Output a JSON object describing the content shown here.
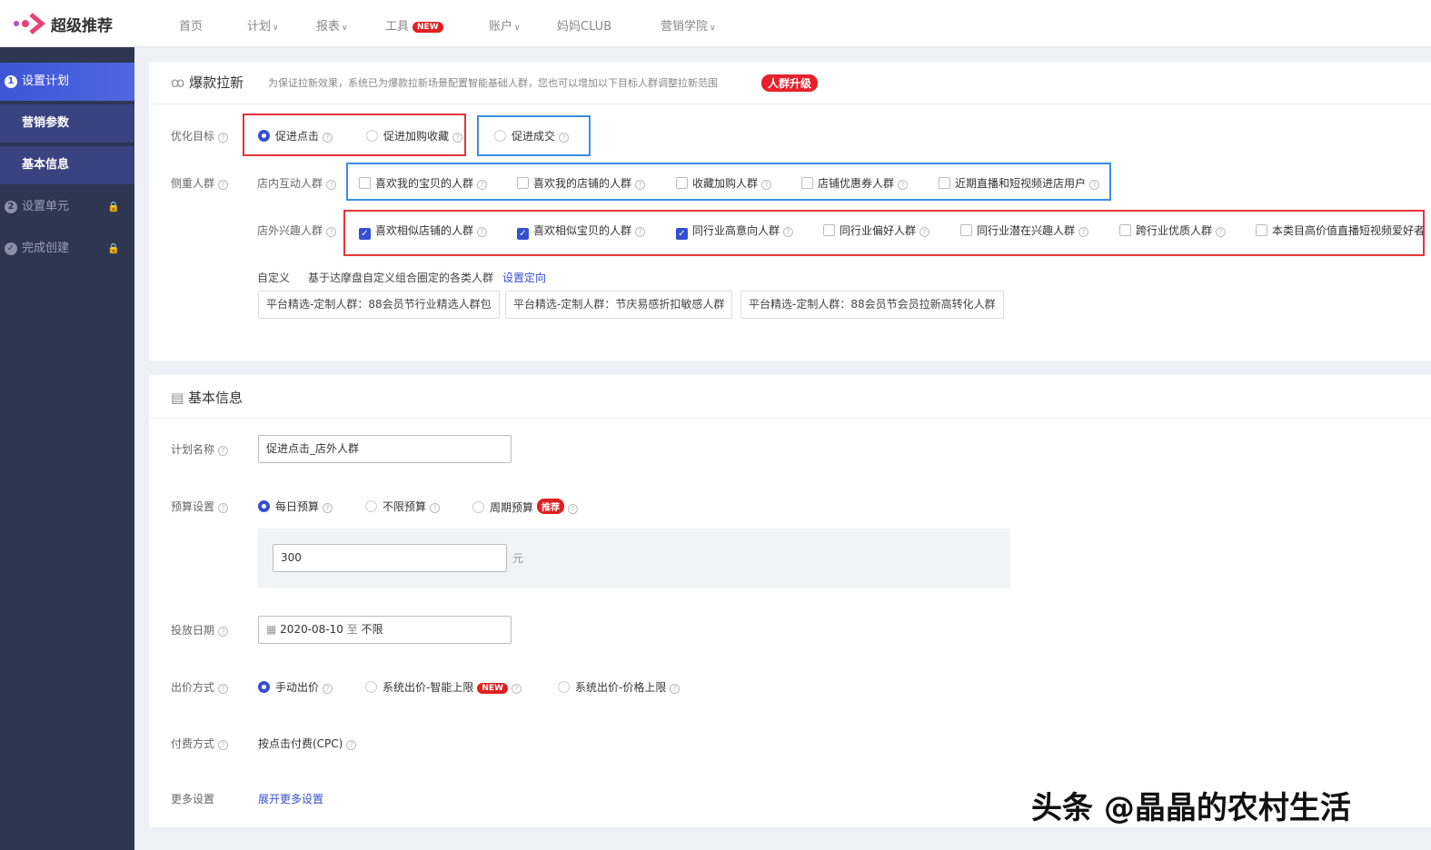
{
  "header": {
    "logo": "超级推荐",
    "nav": [
      {
        "label": "首页",
        "dropdown": false
      },
      {
        "label": "计划",
        "dropdown": true
      },
      {
        "label": "报表",
        "dropdown": true
      },
      {
        "label": "工具",
        "badge": "NEW"
      },
      {
        "label": "账户",
        "dropdown": true
      },
      {
        "label": "妈妈CLUB",
        "dropdown": false
      },
      {
        "label": "营销学院",
        "dropdown": true
      }
    ]
  },
  "sidebar": {
    "items": [
      {
        "num": "1",
        "label": "设置计划"
      },
      {
        "label": "营销参数"
      },
      {
        "label": "基本信息"
      },
      {
        "num": "2",
        "label": "设置单元"
      },
      {
        "label": "完成创建"
      }
    ]
  },
  "scene": {
    "title": "爆款拉新",
    "desc": "为保证拉新效果，系统已为爆款拉新场景配置智能基础人群，您也可以增加以下目标人群调整拉新范围",
    "upgrade": "人群升级",
    "goal_label": "优化目标",
    "goals": [
      "促进点击",
      "促进加购收藏",
      "促进成交"
    ],
    "goal_selected": "促进点击",
    "crowd_label": "侧重人群",
    "instore_label": "店内互动人群",
    "instore": [
      "喜欢我的宝贝的人群",
      "喜欢我的店铺的人群",
      "收藏加购人群",
      "店铺优惠券人群",
      "近期直播和短视频进店用户"
    ],
    "outstore_label": "店外兴趣人群",
    "outstore": [
      {
        "label": "喜欢相似店铺的人群",
        "checked": true
      },
      {
        "label": "喜欢相似宝贝的人群",
        "checked": true
      },
      {
        "label": "同行业高意向人群",
        "checked": true
      },
      {
        "label": "同行业偏好人群",
        "checked": false
      },
      {
        "label": "同行业潜在兴趣人群",
        "checked": false
      },
      {
        "label": "跨行业优质人群",
        "checked": false
      },
      {
        "label": "本类目高价值直播短视频爱好者",
        "checked": false
      }
    ],
    "custom_label": "自定义",
    "custom_desc": "基于达摩盘自定义组合圈定的各类人群",
    "custom_link": "设置定向",
    "custom_tags": [
      "平台精选-定制人群：88会员节行业精选人群包",
      "平台精选-定制人群：节庆易感折扣敏感人群",
      "平台精选-定制人群：88会员节会员拉新高转化人群"
    ]
  },
  "basic": {
    "title": "基本信息",
    "plan_name_label": "计划名称",
    "plan_name": "促进点击_店外人群",
    "budget_label": "预算设置",
    "budget_options": [
      "每日预算",
      "不限预算",
      "周期预算"
    ],
    "budget_badge": "推荐",
    "budget_value": "300",
    "budget_unit": "元",
    "date_label": "投放日期",
    "date_start": "2020-08-10",
    "date_sep": "至",
    "date_end": "不限",
    "bid_label": "出价方式",
    "bid_options": [
      "手动出价",
      "系统出价-智能上限",
      "系统出价-价格上限"
    ],
    "bid_badge": "NEW",
    "pay_label": "付费方式",
    "pay_value": "按点击付费(CPC)",
    "more_label": "更多设置",
    "more_link": "展开更多设置"
  },
  "watermark": "头条 @晶晶的农村生活",
  "colors": {
    "primary": "#3450d2",
    "sidebar": "#2f3652",
    "highlight_red": "#e8333a",
    "highlight_blue": "#3a8ee0"
  }
}
